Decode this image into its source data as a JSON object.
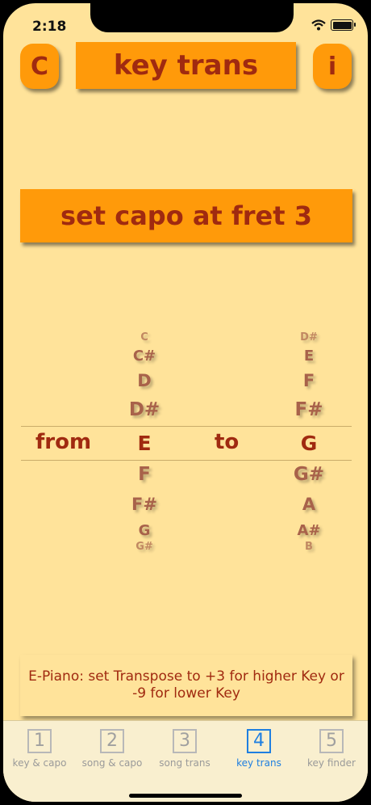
{
  "status_bar": {
    "time": "2:18"
  },
  "header": {
    "left_button": "C",
    "title": "key trans",
    "info_button": "i"
  },
  "capo": {
    "text": "set capo at fret  3"
  },
  "transposer": {
    "from_label": "from",
    "to_label": "to",
    "from_wheel": {
      "above": [
        "C",
        "C#",
        "D",
        "D#"
      ],
      "selected": "E",
      "below": [
        "F",
        "F#",
        "G",
        "G#"
      ]
    },
    "to_wheel": {
      "above": [
        "D#",
        "E",
        "F",
        "F#"
      ],
      "selected": "G",
      "below": [
        "G#",
        "A",
        "A#",
        "B"
      ]
    }
  },
  "epiano_note": "E-Piano: set Transpose to +3 for higher Key or -9 for lower Key",
  "tabs": [
    {
      "number": "1",
      "label": "key & capo"
    },
    {
      "number": "2",
      "label": "song & capo"
    },
    {
      "number": "3",
      "label": "song trans"
    },
    {
      "number": "4",
      "label": "key trans",
      "active": true
    },
    {
      "number": "5",
      "label": "key finder"
    }
  ],
  "colors": {
    "background": "#ffe39a",
    "accent": "#ff9a0a",
    "text": "#a02a10",
    "tab_active": "#1f7fe0"
  }
}
